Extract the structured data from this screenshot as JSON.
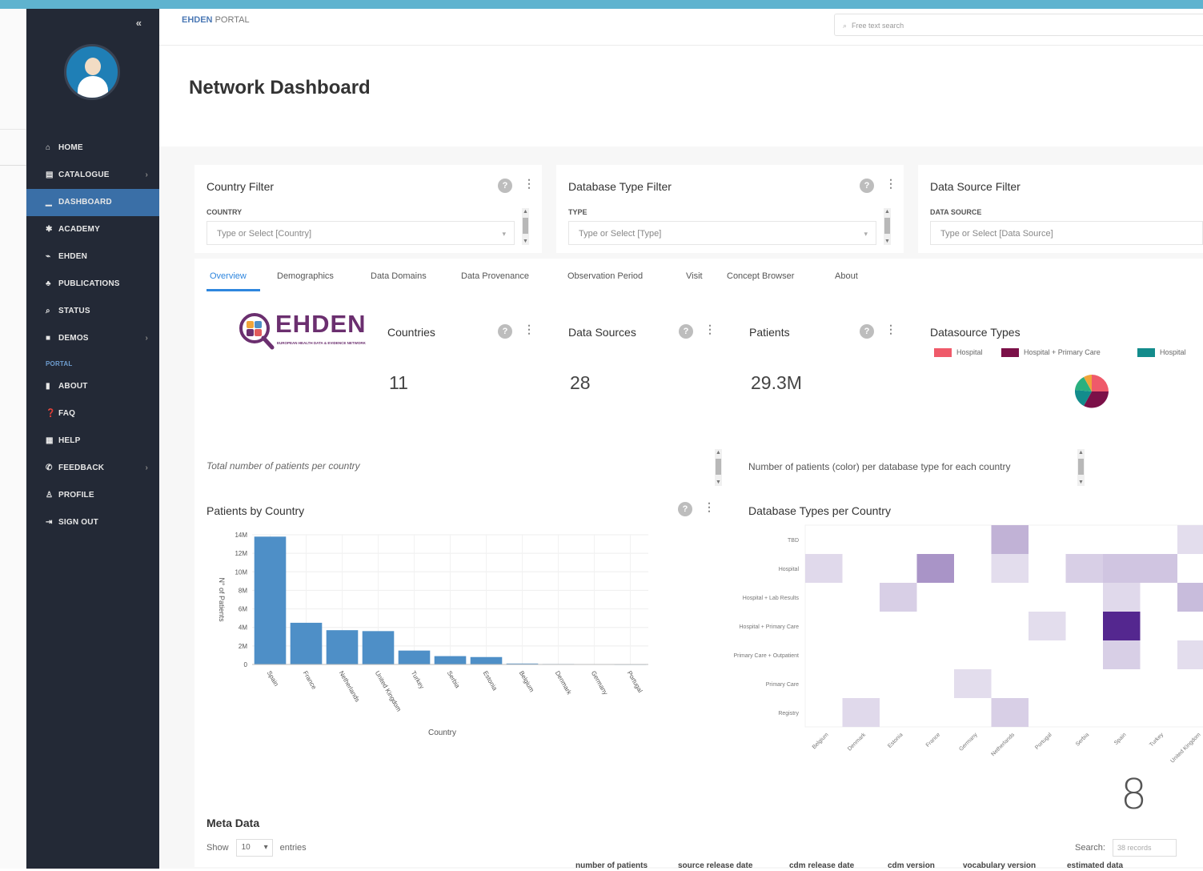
{
  "app": {
    "brand_primary": "EHDEN",
    "brand_secondary": "PORTAL",
    "search_placeholder": "Free text search",
    "page_title": "Network Dashboard",
    "slide_number": "8"
  },
  "colors": {
    "sidebar_bg": "#232936",
    "sidebar_active": "#3a6fa7",
    "accent": "#2e86de",
    "bar": "#4e8fc7",
    "heat_dark": "#5b2d90"
  },
  "sidebar": {
    "collapse_icon": "«",
    "items": [
      {
        "label": "HOME",
        "icon": "home-icon",
        "glyph": "⌂",
        "chevron": ""
      },
      {
        "label": "CATALOGUE",
        "icon": "book-icon",
        "glyph": "▤",
        "chevron": "›"
      },
      {
        "label": "DASHBOARD",
        "icon": "chart-icon",
        "glyph": "▁",
        "chevron": ""
      },
      {
        "label": "ACADEMY",
        "icon": "graduation-icon",
        "glyph": "✱",
        "chevron": ""
      },
      {
        "label": "EHDEN",
        "icon": "link-icon",
        "glyph": "⌁",
        "chevron": ""
      },
      {
        "label": "PUBLICATIONS",
        "icon": "users-icon",
        "glyph": "♣",
        "chevron": ""
      },
      {
        "label": "STATUS",
        "icon": "search-icon",
        "glyph": "⌕",
        "chevron": ""
      },
      {
        "label": "DEMOS",
        "icon": "folder-icon",
        "glyph": "■",
        "chevron": "›"
      }
    ],
    "section_label": "PORTAL",
    "portal_items": [
      {
        "label": "ABOUT",
        "icon": "bookmark-icon",
        "glyph": "▮",
        "chevron": ""
      },
      {
        "label": "FAQ",
        "icon": "question-icon",
        "glyph": "❓",
        "chevron": ""
      },
      {
        "label": "HELP",
        "icon": "help-icon",
        "glyph": "▦",
        "chevron": ""
      },
      {
        "label": "FEEDBACK",
        "icon": "phone-icon",
        "glyph": "✆",
        "chevron": "›"
      },
      {
        "label": "PROFILE",
        "icon": "user-icon",
        "glyph": "♙",
        "chevron": ""
      },
      {
        "label": "SIGN OUT",
        "icon": "sign-out-icon",
        "glyph": "⇥",
        "chevron": ""
      }
    ]
  },
  "filters": [
    {
      "title": "Country Filter",
      "label": "COUNTRY",
      "placeholder": "Type or Select [Country]"
    },
    {
      "title": "Database Type Filter",
      "label": "TYPE",
      "placeholder": "Type or Select [Type]"
    },
    {
      "title": "Data Source Filter",
      "label": "DATA SOURCE",
      "placeholder": "Type or Select [Data Source]"
    }
  ],
  "tabs": [
    "Overview",
    "Demographics",
    "Data Domains",
    "Data Provenance",
    "Observation Period",
    "Visit",
    "Concept Browser",
    "About"
  ],
  "stats": [
    {
      "label": "Countries",
      "value": "11"
    },
    {
      "label": "Data Sources",
      "value": "28"
    },
    {
      "label": "Patients",
      "value": "29.3M"
    }
  ],
  "logo": {
    "text": "EHDEN",
    "tagline": "EUROPEAN HEALTH DATA & EVIDENCE NETWORK"
  },
  "datasource_types": {
    "title": "Datasource Types",
    "legend": [
      {
        "label": "Hospital",
        "color": "#ef5a6a"
      },
      {
        "label": "Hospital + Primary Care",
        "color": "#7b1048"
      },
      {
        "label": "Hospital",
        "color": "#138c8c"
      }
    ]
  },
  "left_chart": {
    "description": "Total number of patients per country",
    "title": "Patients by Country"
  },
  "right_chart": {
    "description": "Number of patients (color) per database type for each country",
    "title": "Database Types per Country"
  },
  "chart_data": [
    {
      "type": "bar",
      "title": "Patients by Country",
      "xlabel": "Country",
      "ylabel": "N° of Patients",
      "categories": [
        "Spain",
        "France",
        "Netherlands",
        "United Kingdom",
        "Turkey",
        "Serbia",
        "Estonia",
        "Belgium",
        "Denmark",
        "Germany",
        "Portugal"
      ],
      "values": [
        13.8,
        4.5,
        3.7,
        3.6,
        1.5,
        0.9,
        0.8,
        0.1,
        0.05,
        0.03,
        0.02
      ],
      "ylim": [
        0,
        14
      ],
      "ytick_labels": [
        "0",
        "2M",
        "4M",
        "6M",
        "8M",
        "10M",
        "12M",
        "14M"
      ],
      "ytick_values": [
        0,
        2,
        4,
        6,
        8,
        10,
        12,
        14
      ],
      "grid": true
    },
    {
      "type": "heatmap",
      "title": "Database Types per Country",
      "rows": [
        "TBD",
        "Hospital",
        "Hospital + Lab Results",
        "Hospital + Primary Care",
        "Primary Care + Outpatient",
        "Primary Care",
        "Registry"
      ],
      "columns": [
        "Belgium",
        "Denmark",
        "Estonia",
        "France",
        "Germany",
        "Netherlands",
        "Portugal",
        "Serbia",
        "Spain",
        "Turkey",
        "United Kingdom"
      ],
      "cells": [
        {
          "r": 0,
          "c": 5,
          "v": 0.3
        },
        {
          "r": 0,
          "c": 10,
          "v": 0.08
        },
        {
          "r": 1,
          "c": 0,
          "v": 0.1
        },
        {
          "r": 1,
          "c": 3,
          "v": 0.45
        },
        {
          "r": 1,
          "c": 5,
          "v": 0.08
        },
        {
          "r": 1,
          "c": 7,
          "v": 0.15
        },
        {
          "r": 1,
          "c": 8,
          "v": 0.2
        },
        {
          "r": 1,
          "c": 9,
          "v": 0.2
        },
        {
          "r": 2,
          "c": 2,
          "v": 0.15
        },
        {
          "r": 2,
          "c": 8,
          "v": 0.1
        },
        {
          "r": 2,
          "c": 10,
          "v": 0.25
        },
        {
          "r": 3,
          "c": 6,
          "v": 0.08
        },
        {
          "r": 3,
          "c": 8,
          "v": 1.0
        },
        {
          "r": 4,
          "c": 8,
          "v": 0.15
        },
        {
          "r": 4,
          "c": 10,
          "v": 0.08
        },
        {
          "r": 5,
          "c": 4,
          "v": 0.08
        },
        {
          "r": 6,
          "c": 1,
          "v": 0.1
        },
        {
          "r": 6,
          "c": 5,
          "v": 0.15
        }
      ]
    }
  ],
  "meta": {
    "title": "Meta Data",
    "show": "Show",
    "entries_value": "10",
    "entries": "entries",
    "search": "Search:",
    "search_placeholder": "38 records",
    "columns": [
      "number of patients",
      "source release date",
      "cdm release date",
      "cdm version",
      "vocabulary version",
      "estimated data"
    ]
  }
}
